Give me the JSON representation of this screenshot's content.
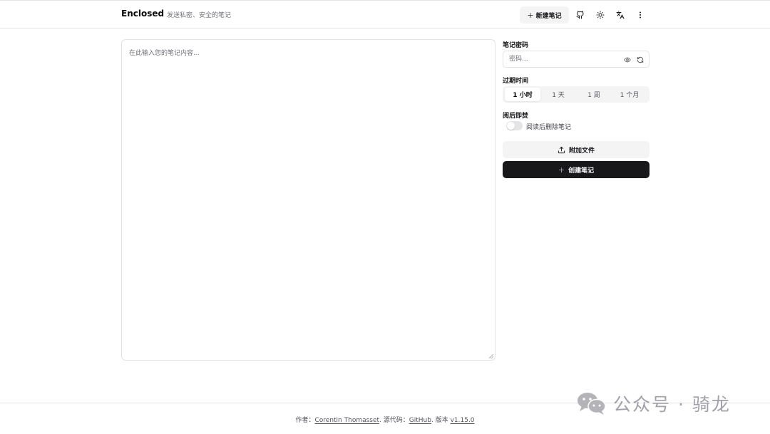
{
  "header": {
    "brand": "Enclosed",
    "tagline": "发送私密、安全的笔记",
    "new_note_icon": "+",
    "new_note_label": "新建笔记",
    "icons": [
      "github-icon",
      "sun-icon",
      "language-icon",
      "more-vertical-icon"
    ]
  },
  "editor": {
    "placeholder": "在此输入您的笔记内容..."
  },
  "sidebar": {
    "password_label": "笔记密码",
    "password_placeholder": "密码...",
    "expiration_label": "过期时间",
    "expiration_options": [
      "1 小时",
      "1 天",
      "1 周",
      "1 个月"
    ],
    "expiration_selected": "1 小时",
    "burn_label": "阅后即焚",
    "burn_toggle_label": "阅读后删除笔记",
    "burn_enabled": false,
    "attach_label": "附加文件",
    "create_icon": "+",
    "create_label": "创建笔记"
  },
  "footer": {
    "author_prefix": "作者：",
    "author_name": "Corentin Thomasset",
    "source_prefix": ". 源代码：",
    "source_link": "GitHub",
    "version_prefix": ". 版本 ",
    "version": "v1.15.0"
  },
  "watermark": {
    "text": "公众号 · 骑龙"
  },
  "colors": {
    "primary": "#18181b",
    "muted_bg": "#f4f4f5",
    "border": "#e4e4e7",
    "muted_text": "#71717a"
  }
}
